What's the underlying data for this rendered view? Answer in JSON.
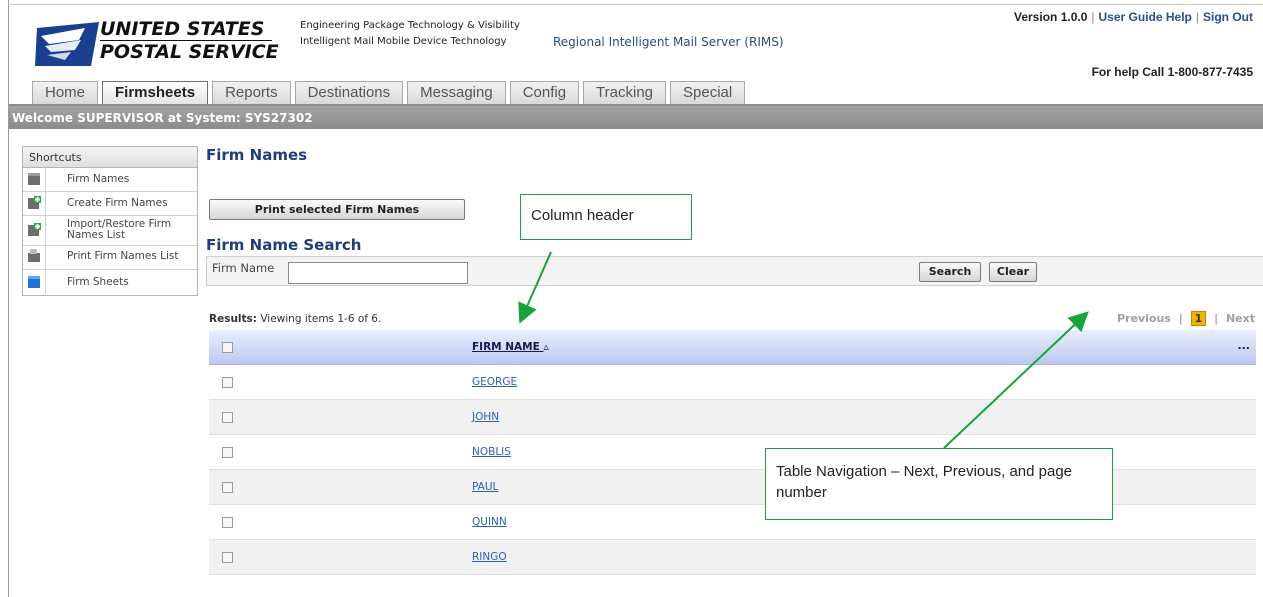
{
  "brand": {
    "line1": "UNITED STATES",
    "line2": "POSTAL SERVICE",
    "tagline1": "Engineering Package Technology & Visibility",
    "tagline2": "Intelligent Mail Mobile Device Technology",
    "app_name": "Regional Intelligent Mail Server (RIMS)"
  },
  "top_links": {
    "version": "Version 1.0.0",
    "sep1": "|",
    "guide": "User Guide Help",
    "sep2": "|",
    "signout": "Sign Out",
    "help_call": "For help Call 1-800-877-7435"
  },
  "tabs": [
    {
      "label": "Home"
    },
    {
      "label": "Firmsheets",
      "active": true
    },
    {
      "label": "Reports"
    },
    {
      "label": "Destinations"
    },
    {
      "label": "Messaging"
    },
    {
      "label": "Config"
    },
    {
      "label": "Tracking"
    },
    {
      "label": "Special"
    }
  ],
  "welcome": "Welcome SUPERVISOR at System: SYS27302",
  "shortcuts": {
    "title": "Shortcuts",
    "items": [
      {
        "label": "Firm Names"
      },
      {
        "label": "Create Firm Names"
      },
      {
        "label": "Import/Restore Firm Names List"
      },
      {
        "label": "Print Firm Names List"
      },
      {
        "label": "Firm Sheets"
      }
    ]
  },
  "main": {
    "title": "Firm Names",
    "print_button": "Print selected Firm Names",
    "search_title": "Firm Name Search",
    "search_label": "Firm Name",
    "search_value": "",
    "search_button": "Search",
    "clear_button": "Clear",
    "results_label": "Results:",
    "results_text": "Viewing items 1-6 of 6.",
    "pager": {
      "previous": "Previous",
      "sep": "|",
      "page": "1",
      "next": "Next"
    },
    "column_header": "FIRM NAME",
    "sort_icon": "▵",
    "more": "...",
    "rows": [
      "GEORGE",
      "JOHN",
      "NOBLIS",
      "PAUL",
      "QUINN",
      "RINGO"
    ]
  },
  "annotations": {
    "column_header": "Column header",
    "table_nav": "Table Navigation – Next, Previous, and page number"
  },
  "colors": {
    "accent_green": "#1aa33a",
    "title_blue": "#1f3d7a",
    "link_blue": "#2d5fb8",
    "page_highlight": "#f0b400"
  }
}
